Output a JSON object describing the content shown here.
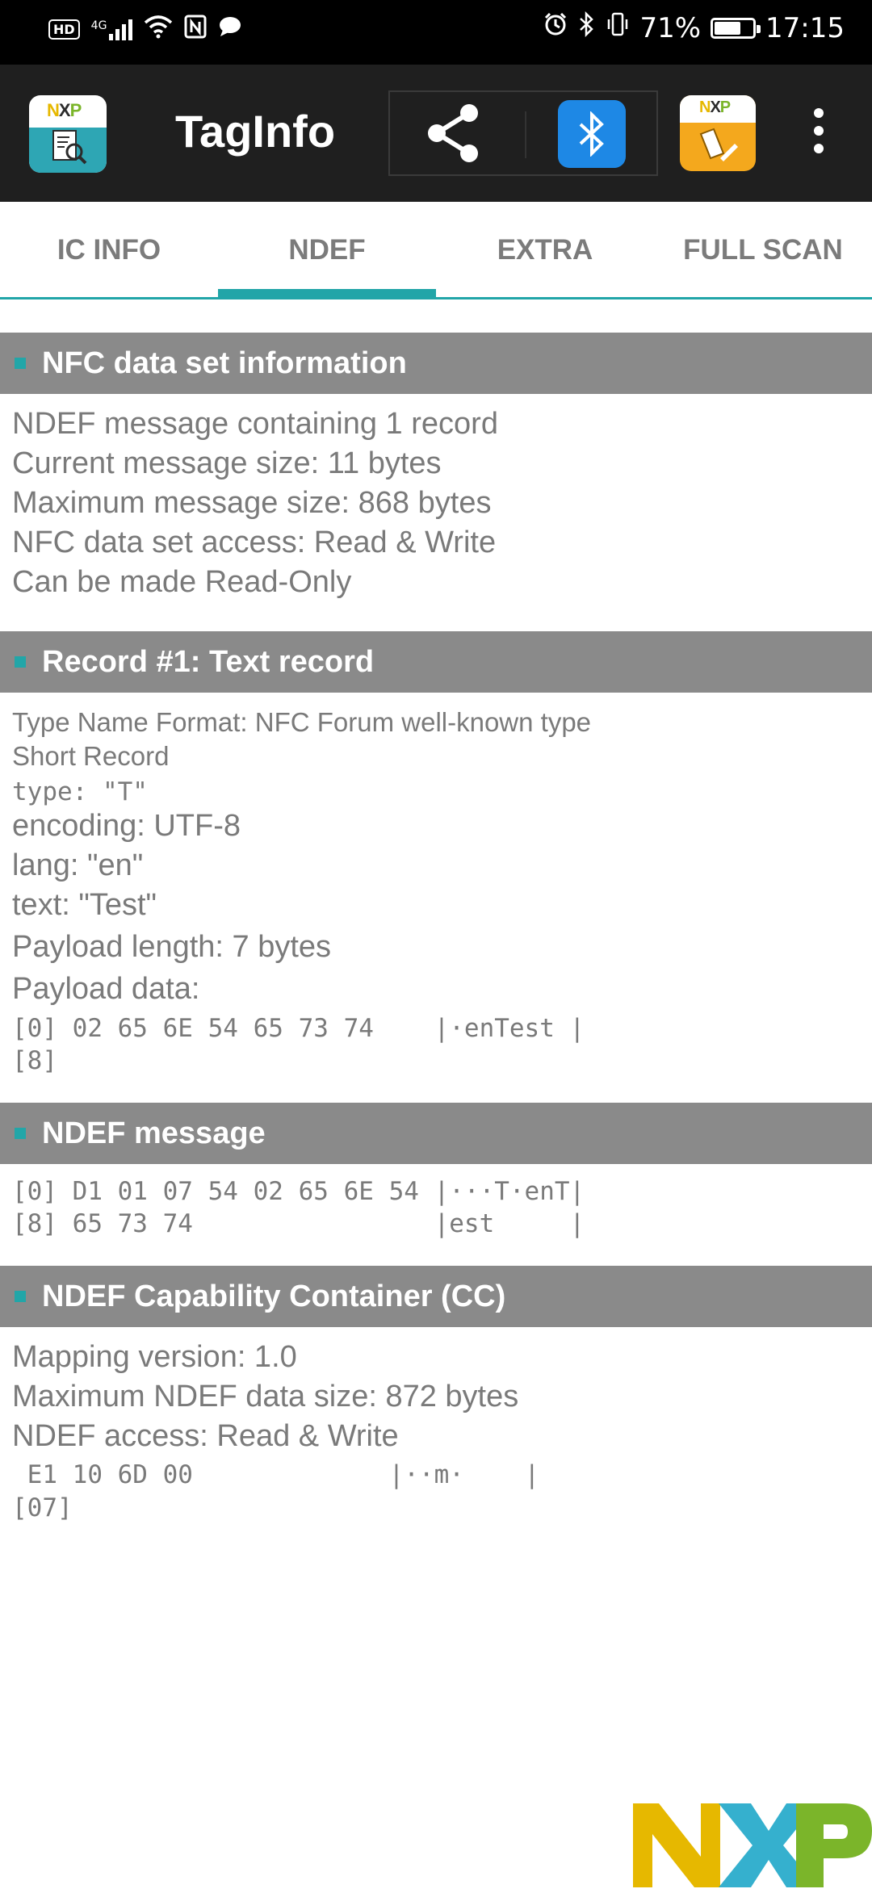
{
  "status_bar": {
    "left_icons": [
      "hd-badge",
      "4g-signal-icon",
      "wifi-icon",
      "nfc-icon",
      "message-icon"
    ],
    "hd_label": "HD",
    "network_label": "4G",
    "battery_percent": 71,
    "battery_text": "71%",
    "time": "17:15"
  },
  "app_bar": {
    "title": "TagInfo",
    "logo_text": "NXP",
    "actions": [
      "share-icon",
      "bluetooth-icon",
      "nxp-app-icon",
      "overflow-menu-icon"
    ]
  },
  "tabs": [
    {
      "label": "IC INFO",
      "active": false
    },
    {
      "label": "NDEF",
      "active": true
    },
    {
      "label": "EXTRA",
      "active": false
    },
    {
      "label": "FULL SCAN",
      "active": false
    }
  ],
  "sections": {
    "nfc_info": {
      "title": "NFC data set information",
      "lines": [
        "NDEF message containing 1 record",
        "Current message size: 11 bytes",
        "Maximum message size: 868 bytes",
        "NFC data set access: Read & Write",
        "Can be made Read-Only"
      ]
    },
    "record1": {
      "title": "Record #1: Text record",
      "tnf": "Type Name Format: NFC Forum well-known type",
      "short_record": "Short Record",
      "type": "type: \"T\"",
      "encoding": "encoding: UTF-8",
      "lang": "lang: \"en\"",
      "text": "text: \"Test\"",
      "payload_length": "Payload length: 7 bytes",
      "payload_label": "Payload data:",
      "hex_lines": [
        "[0] 02 65 6E 54 65 73 74    |·enTest |",
        "[8]"
      ]
    },
    "ndef_message": {
      "title": "NDEF message",
      "hex_lines": [
        "[0] D1 01 07 54 02 65 6E 54 |···T·enT|",
        "[8] 65 73 74                |est     |"
      ]
    },
    "cc": {
      "title": "NDEF Capability Container (CC)",
      "lines": [
        "Mapping version: 1.0",
        "Maximum NDEF data size: 872 bytes",
        "NDEF access: Read & Write"
      ],
      "hex_lines": [
        " E1 10 6D 00             |··m·    |",
        "[07]"
      ]
    }
  },
  "footer_logo": "NXP",
  "colors": {
    "accent": "#21a5a8",
    "header_gray": "#8a8a8a",
    "app_bar": "#1f1f1f",
    "bluetooth": "#1e88e5",
    "nxp_yellow": "#e6b800",
    "nxp_blue": "#1fa7c9",
    "nxp_green": "#7bb52a"
  }
}
